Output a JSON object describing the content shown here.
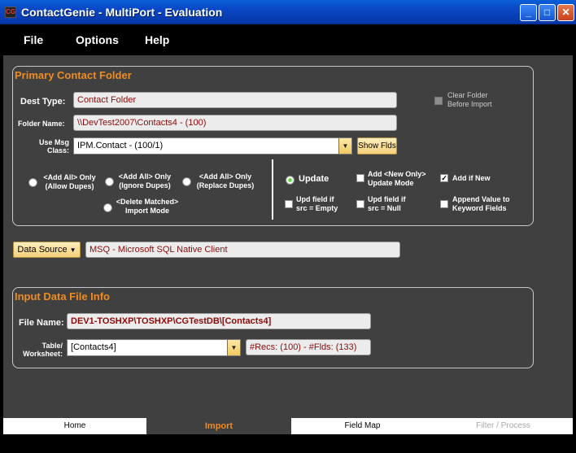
{
  "window": {
    "title": "ContactGenie - MultiPort - Evaluation"
  },
  "menu": {
    "file": "File",
    "options": "Options",
    "help": "Help"
  },
  "primary": {
    "title": "Primary Contact Folder",
    "dest_type_label": "Dest Type:",
    "dest_type_value": "Contact Folder",
    "folder_name_label": "Folder Name:",
    "folder_name_value": "\\\\DevTest2007\\Contacts4 - (100)",
    "msg_class_label_1": "Use Msg",
    "msg_class_label_2": "Class:",
    "msg_class_value": "IPM.Contact - (100/1)",
    "show_flds": "Show Flds",
    "clear_folder_1": "Clear Folder",
    "clear_folder_2": "Before Import",
    "modes": {
      "add_all_allow_1": "<Add All> Only",
      "add_all_allow_2": "(Allow Dupes)",
      "add_all_ignore_1": "<Add All> Only",
      "add_all_ignore_2": "(Ignore Dupes)",
      "add_all_replace_1": "<Add All> Only",
      "add_all_replace_2": "(Replace Dupes)",
      "delete_matched_1": "<Delete Matched>",
      "delete_matched_2": "Import Mode",
      "update": "Update",
      "add_new_only_1": "Add <New Only>",
      "add_new_only_2": "Update Mode",
      "add_if_new": "Add if New",
      "upd_empty_1": "Upd field if",
      "upd_empty_2": "src =  Empty",
      "upd_null_1": "Upd field if",
      "upd_null_2": "src = Null",
      "append_1": "Append Value to",
      "append_2": "Keyword Fields"
    }
  },
  "datasource": {
    "button_label": "Data Source",
    "value": "MSQ - Microsoft SQL Native Client"
  },
  "input": {
    "title": "Input Data File Info",
    "file_name_label": "File Name:",
    "file_name_value": "DEV1-TOSHXP\\TOSHXP\\CGTestDB\\[Contacts4]",
    "table_label_1": "Table/",
    "table_label_2": "Worksheet:",
    "table_value": "[Contacts4]",
    "recs_info": "#Recs: (100) - #Flds: (133)"
  },
  "tabs": {
    "home": "Home",
    "import": "Import",
    "field_map": "Field Map",
    "filter": "Filter / Process"
  }
}
